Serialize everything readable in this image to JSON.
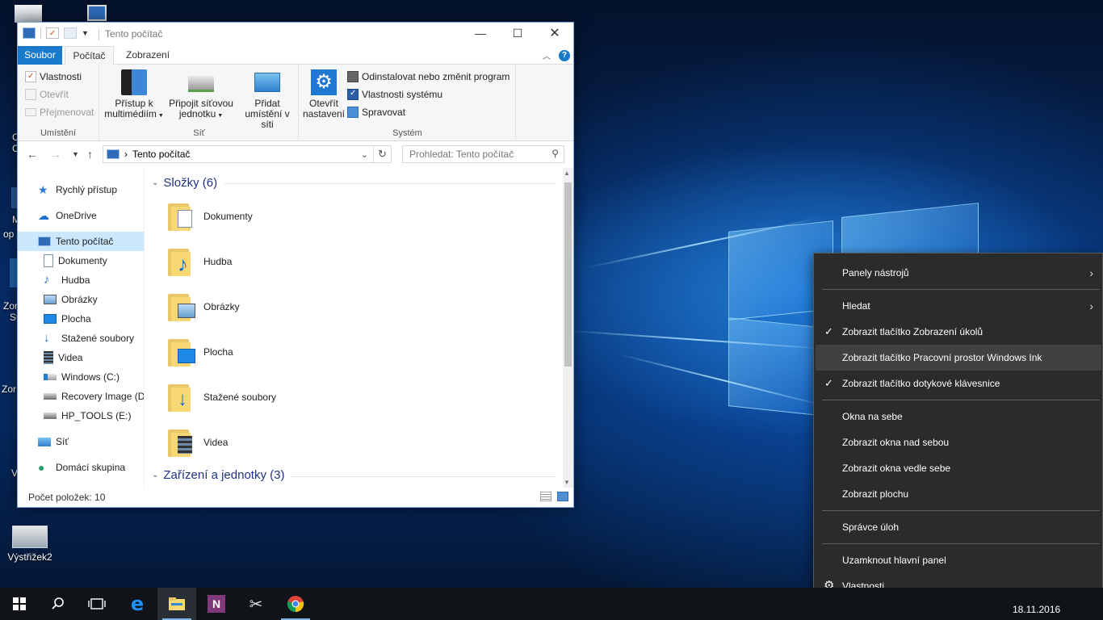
{
  "desktop": {
    "icons": [
      {
        "label": "Výstřižek2"
      }
    ],
    "partial_labels": [
      "C",
      "C",
      "M",
      "op",
      "Zor",
      "St",
      "Zor",
      "V"
    ]
  },
  "explorer": {
    "title": "Tento počítač",
    "window_controls": {
      "minimize": "—",
      "maximize": "☐",
      "close": "✕"
    },
    "tabs": {
      "file": "Soubor",
      "computer": "Počítač",
      "view": "Zobrazení"
    },
    "ribbon": {
      "location_group": {
        "label": "Umístění",
        "properties": "Vlastnosti",
        "open": "Otevřít",
        "rename": "Přejmenovat"
      },
      "network_group": {
        "label": "Síť",
        "media_line1": "Přístup k",
        "media_line2": "multimédiím",
        "map_drive_line1": "Připojit síťovou",
        "map_drive_line2": "jednotku",
        "add_location_line1": "Přidat",
        "add_location_line2": "umístění v síti"
      },
      "system_group": {
        "label": "Systém",
        "open_settings_line1": "Otevřít",
        "open_settings_line2": "nastavení",
        "uninstall": "Odinstalovat nebo změnit program",
        "system_properties": "Vlastnosti systému",
        "manage": "Spravovat"
      }
    },
    "address": {
      "path": "Tento počítač",
      "search_placeholder": "Prohledat: Tento počítač"
    },
    "nav_pane": [
      {
        "label": "Rychlý přístup",
        "icon": "star-icon",
        "indent": 0
      },
      {
        "label": "OneDrive",
        "icon": "cloud-icon",
        "indent": 0
      },
      {
        "label": "Tento počítač",
        "icon": "computer-icon",
        "indent": 0,
        "selected": true
      },
      {
        "label": "Dokumenty",
        "icon": "document-icon",
        "indent": 1
      },
      {
        "label": "Hudba",
        "icon": "music-icon",
        "indent": 1
      },
      {
        "label": "Obrázky",
        "icon": "pictures-icon",
        "indent": 1
      },
      {
        "label": "Plocha",
        "icon": "desktop-icon",
        "indent": 1
      },
      {
        "label": "Stažené soubory",
        "icon": "download-icon",
        "indent": 1
      },
      {
        "label": "Videa",
        "icon": "video-icon",
        "indent": 1
      },
      {
        "label": "Windows (C:)",
        "icon": "drive-icon",
        "indent": 1
      },
      {
        "label": "Recovery Image (D:",
        "icon": "drive-icon",
        "indent": 1
      },
      {
        "label": "HP_TOOLS (E:)",
        "icon": "drive-icon",
        "indent": 1
      },
      {
        "label": "Síť",
        "icon": "network-icon",
        "indent": 0
      },
      {
        "label": "Domácí skupina",
        "icon": "homegroup-icon",
        "indent": 0
      }
    ],
    "content": {
      "folders_header": "Složky (6)",
      "folders": [
        {
          "label": "Dokumenty",
          "icon": "document-icon"
        },
        {
          "label": "Hudba",
          "icon": "music-icon"
        },
        {
          "label": "Obrázky",
          "icon": "pictures-icon"
        },
        {
          "label": "Plocha",
          "icon": "desktop-icon"
        },
        {
          "label": "Stažené soubory",
          "icon": "download-icon"
        },
        {
          "label": "Videa",
          "icon": "video-icon"
        }
      ],
      "devices_header": "Zařízení a jednotky (3)"
    },
    "status": "Počet položek: 10"
  },
  "context_menu": {
    "items": [
      {
        "label": "Panely nástrojů",
        "submenu": true
      },
      {
        "label": "Hledat",
        "submenu": true
      },
      {
        "label": "Zobrazit tlačítko Zobrazení úkolů",
        "checked": true
      },
      {
        "label": "Zobrazit tlačítko Pracovní prostor Windows Ink",
        "hover": true
      },
      {
        "label": "Zobrazit tlačítko dotykové klávesnice",
        "checked": true
      },
      {
        "label": "Okna na sebe"
      },
      {
        "label": "Zobrazit okna nad sebou"
      },
      {
        "label": "Zobrazit okna vedle sebe"
      },
      {
        "label": "Zobrazit plochu"
      },
      {
        "label": "Správce úloh"
      },
      {
        "label": "Uzamknout hlavní panel"
      },
      {
        "label": "Vlastnosti",
        "icon": "gear-icon"
      }
    ],
    "chevron": "›",
    "check": "✓",
    "gear": "⚙"
  },
  "taskbar": {
    "date": "18.11.2016",
    "apps": [
      "start-icon",
      "search-icon",
      "task-view-icon",
      "edge-icon",
      "file-explorer-icon",
      "onenote-icon",
      "snipping-tool-icon",
      "chrome-icon"
    ]
  },
  "colors": {
    "accent": "#1979ca",
    "menu_bg": "#2b2b2b",
    "menu_hover": "#414141",
    "selection": "#cce8ff",
    "taskbar": "#101418"
  }
}
